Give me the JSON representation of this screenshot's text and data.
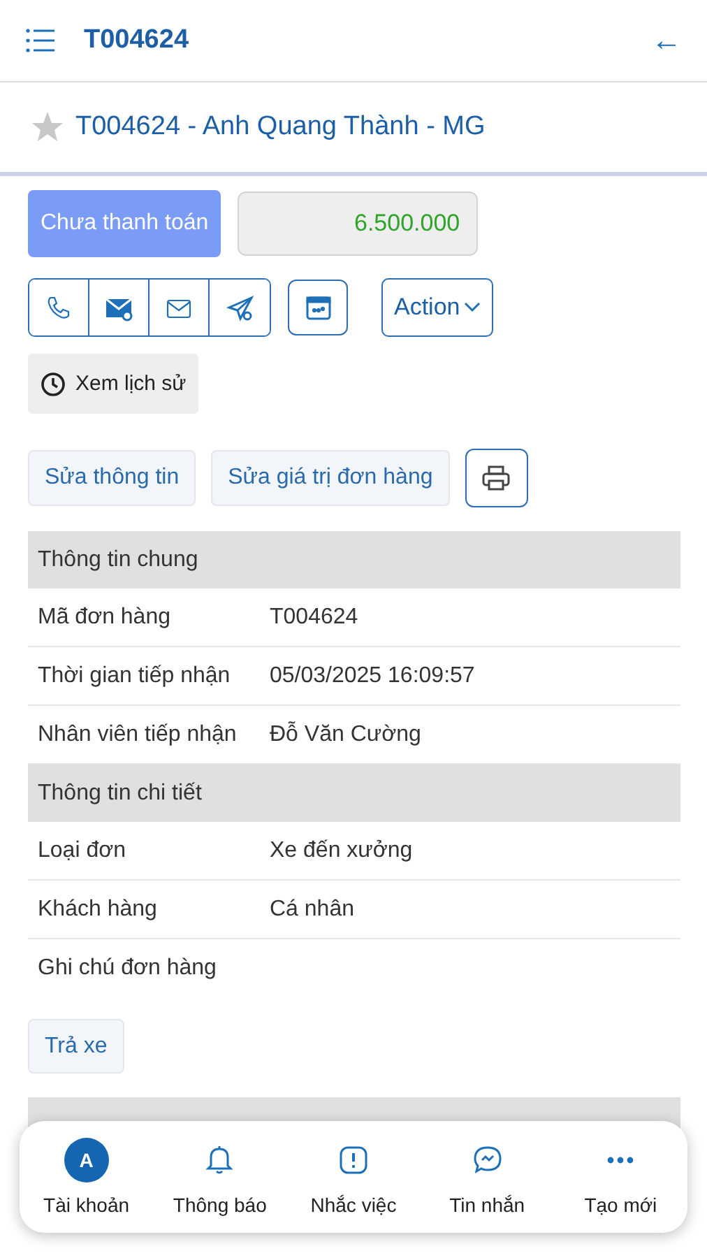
{
  "header": {
    "title": "T004624",
    "back_icon": "←"
  },
  "order_title": {
    "text": "T004624 - Anh Quang Thành - MG",
    "starred": false
  },
  "payment": {
    "status": "Chưa thanh toán",
    "amount": "6.500.000"
  },
  "action_button": "Action",
  "history_button": "Xem lịch sử",
  "edit_buttons": [
    "Sửa thông tin",
    "Sửa giá trị đơn hàng"
  ],
  "sections": [
    {
      "title": "Thông tin chung",
      "rows": [
        {
          "label": "Mã đơn hàng",
          "value": "T004624"
        },
        {
          "label": "Thời gian tiếp nhận",
          "value": "05/03/2025 16:09:57"
        },
        {
          "label": "Nhân viên tiếp nhận",
          "value": "Đỗ Văn Cường"
        }
      ]
    },
    {
      "title": "Thông tin chi tiết",
      "rows": [
        {
          "label": "Loại đơn",
          "value": "Xe đến xưởng"
        },
        {
          "label": "Khách hàng",
          "value": "Cá nhân"
        },
        {
          "label": "Ghi chú đơn hàng"
        }
      ]
    }
  ],
  "return_button": "Trả xe",
  "bottom_nav": [
    {
      "kind": "avatar",
      "label": "Tài khoản",
      "avatar_letter": "A"
    },
    {
      "kind": "bell",
      "label": "Thông báo"
    },
    {
      "kind": "alert",
      "label": "Nhắc việc"
    },
    {
      "kind": "chat",
      "label": "Tin nhắn"
    },
    {
      "kind": "more",
      "label": "Tạo mới"
    }
  ]
}
